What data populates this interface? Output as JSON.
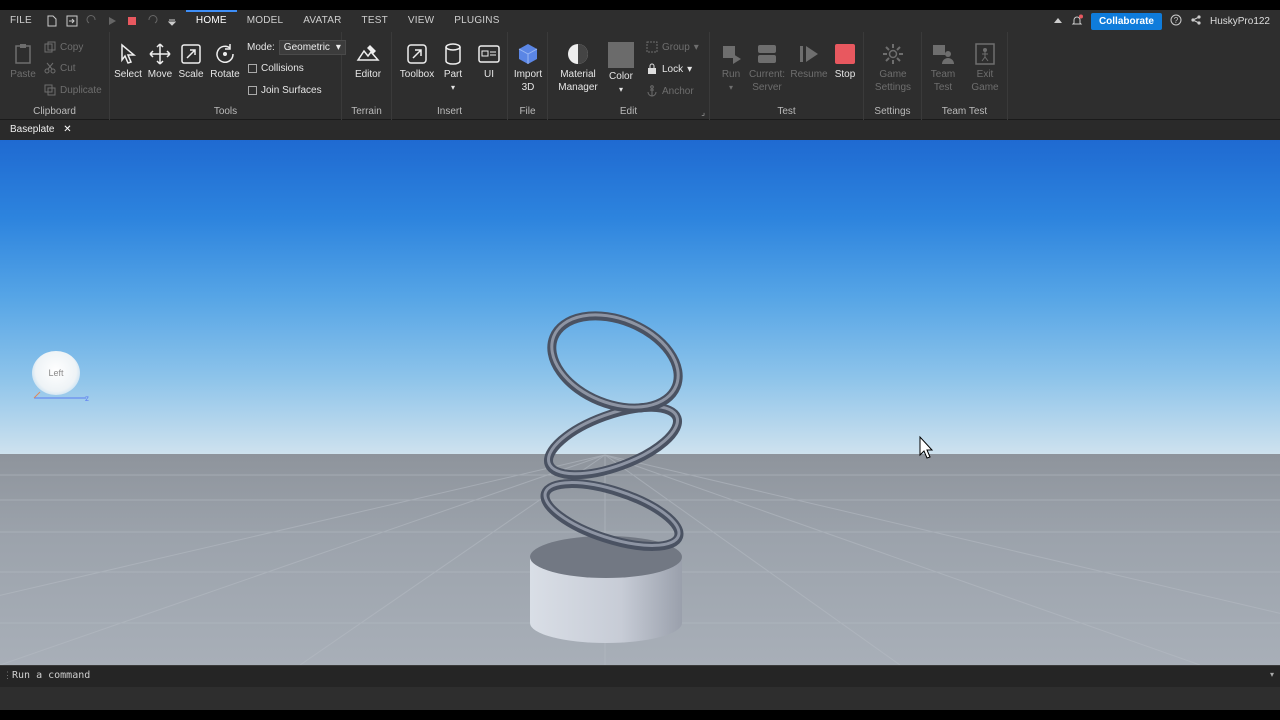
{
  "menu": {
    "file": "FILE",
    "tabs": [
      "HOME",
      "MODEL",
      "AVATAR",
      "TEST",
      "VIEW",
      "PLUGINS"
    ],
    "active_tab": "HOME",
    "collaborate": "Collaborate",
    "username": "HuskyPro122"
  },
  "ribbon": {
    "clipboard": {
      "label": "Clipboard",
      "paste": "Paste",
      "copy": "Copy",
      "cut": "Cut",
      "duplicate": "Duplicate"
    },
    "tools": {
      "label": "Tools",
      "select": "Select",
      "move": "Move",
      "scale": "Scale",
      "rotate": "Rotate",
      "mode_label": "Mode:",
      "mode_value": "Geometric",
      "collisions": "Collisions",
      "join_surfaces": "Join Surfaces"
    },
    "terrain": {
      "label": "Terrain",
      "editor": "Editor"
    },
    "insert": {
      "label": "Insert",
      "toolbox": "Toolbox",
      "part": "Part",
      "ui": "UI"
    },
    "file": {
      "label": "File",
      "import": "Import",
      "import2": "3D"
    },
    "edit": {
      "label": "Edit",
      "material": "Material",
      "material2": "Manager",
      "color": "Color",
      "group": "Group",
      "lock": "Lock",
      "anchor": "Anchor"
    },
    "test": {
      "label": "Test",
      "run": "Run",
      "current": "Current:",
      "server": "Server",
      "resume": "Resume",
      "stop": "Stop"
    },
    "settings": {
      "label": "Settings",
      "game": "Game",
      "game2": "Settings"
    },
    "teamtest": {
      "label": "Team Test",
      "team": "Team",
      "team2": "Test",
      "exit": "Exit",
      "exit2": "Game"
    }
  },
  "document_tab": "Baseplate",
  "viewcube_label": "Left",
  "command_placeholder": "Run a command",
  "colors": {
    "accent": "#3e8ef7",
    "collaborate": "#0f7cdb",
    "stop": "#e8585f"
  }
}
